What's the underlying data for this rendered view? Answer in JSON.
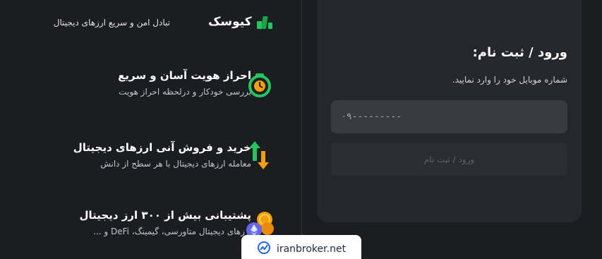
{
  "header": {
    "logo_text": "کیوسک",
    "tagline": "تبادل امن و سریع ارزهای دیجیتال"
  },
  "features": [
    {
      "title": "احراز هویت آسان و سریع",
      "description": "بررسی خودکار و درلحظه احراز هویت",
      "icon": "clock-check-icon"
    },
    {
      "title": "خرید و فروش آنی ارزهای دیجیتال",
      "description": "معامله ارزهای دیجیتال با هر سطح از دانش",
      "icon": "buy-sell-arrows-icon"
    },
    {
      "title": "پشتیبانی بیش از ۳۰۰ ارز دیجیتال",
      "description": "ارزهای دیجیتال متاورسی، گیمینگ، DeFi و ...",
      "icon": "crypto-coins-icon"
    }
  ],
  "login": {
    "title": "ورود / ثبت نام:",
    "hint": "شماره موبایل خود را وارد نمایید.",
    "phone_placeholder": "۰۹---------",
    "submit_label": "ورود / ثبت نام"
  },
  "watermark": {
    "text": "iranbroker.net"
  },
  "colors": {
    "background": "#1c1d21",
    "card": "#26272c",
    "input": "#3a3b41",
    "brand_green": "#22c55e",
    "accent_orange": "#f59e0b"
  }
}
